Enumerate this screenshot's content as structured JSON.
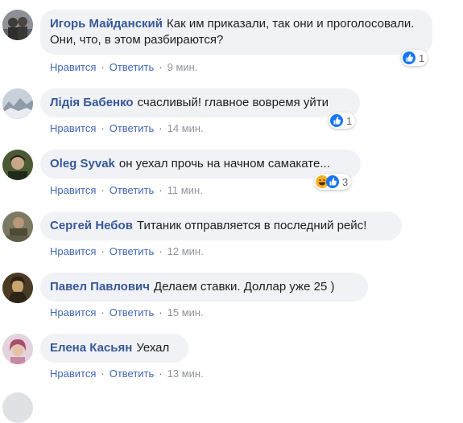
{
  "comments": [
    {
      "author": "Игорь Майданский",
      "text": "Как им приказали, так они и проголосовали. Они, что, в этом разбираются?",
      "like_label": "Нравится",
      "reply_label": "Ответить",
      "time": "9 мин.",
      "reactions": [
        "like"
      ],
      "reaction_count": "1",
      "avatar_color": "#7a7f86"
    },
    {
      "author": "Лідія Бабенко",
      "text": "счасливый! главное вовремя уйти",
      "like_label": "Нравится",
      "reply_label": "Ответить",
      "time": "14 мин.",
      "reactions": [
        "like"
      ],
      "reaction_count": "1",
      "avatar_color": "#b9c4cf"
    },
    {
      "author": "Oleg Syvak",
      "text": "он уехал прочь на начном самакате...",
      "like_label": "Нравится",
      "reply_label": "Ответить",
      "time": "11 мин.",
      "reactions": [
        "haha",
        "like"
      ],
      "reaction_count": "3",
      "avatar_color": "#3b4a2c"
    },
    {
      "author": "Сергей Небов",
      "text": "Титаник отправляется в последний рейс!",
      "like_label": "Нравится",
      "reply_label": "Ответить",
      "time": "12 мин.",
      "reactions": [],
      "reaction_count": "",
      "avatar_color": "#6f6a4e"
    },
    {
      "author": "Павел Павлович",
      "text": "Делаем ставки. Доллар уже 25 )",
      "like_label": "Нравится",
      "reply_label": "Ответить",
      "time": "15 мин.",
      "reactions": [],
      "reaction_count": "",
      "avatar_color": "#5a4a30"
    },
    {
      "author": "Елена Касьян",
      "text": "Уехал",
      "like_label": "Нравится",
      "reply_label": "Ответить",
      "time": "13 мин.",
      "reactions": [],
      "reaction_count": "",
      "avatar_color": "#d9b9c9"
    }
  ],
  "colors": {
    "author": "#385898",
    "bubble": "#f0f2f5",
    "action": "#4267b2",
    "like": "#1877f2",
    "haha": "#f7b125"
  }
}
